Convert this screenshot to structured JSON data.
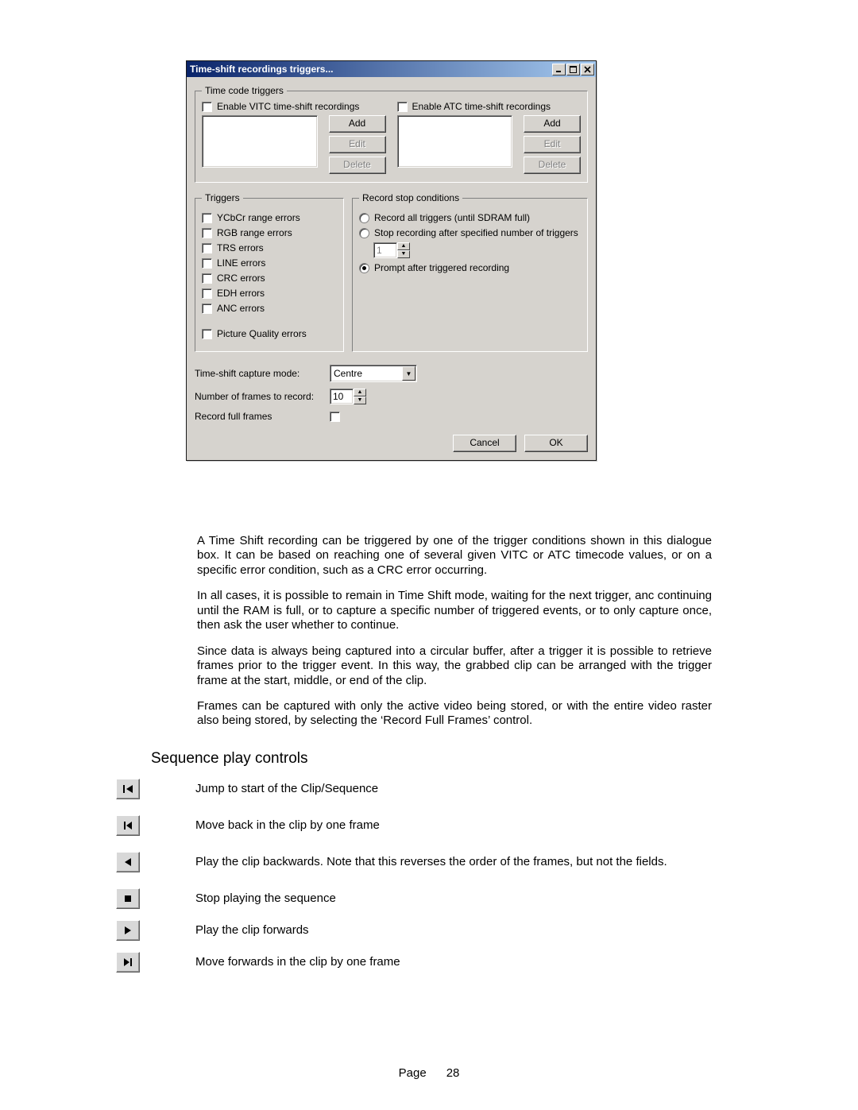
{
  "dialog": {
    "title": "Time-shift recordings triggers...",
    "timecode_triggers": {
      "legend": "Time code triggers",
      "vitc_label": "Enable VITC time-shift recordings",
      "atc_label": "Enable ATC time-shift recordings",
      "add_label": "Add",
      "edit_label": "Edit",
      "delete_label": "Delete"
    },
    "triggers": {
      "legend": "Triggers",
      "items": [
        "YCbCr range errors",
        "RGB range errors",
        "TRS  errors",
        "LINE  errors",
        "CRC  errors",
        "EDH  errors",
        "ANC  errors",
        "Picture Quality errors"
      ]
    },
    "stop": {
      "legend": "Record stop conditions",
      "opt_all": "Record all triggers (until SDRAM full)",
      "opt_num": "Stop recording after specified number of triggers",
      "num_value": "1",
      "opt_prompt": "Prompt after triggered recording",
      "selected": "prompt"
    },
    "capture_mode": {
      "label": "Time-shift capture mode:",
      "value": "Centre"
    },
    "frames": {
      "label": "Number of frames to record:",
      "value": "10"
    },
    "full_frames_label": "Record full frames",
    "cancel": "Cancel",
    "ok": "OK"
  },
  "paragraphs": [
    "A Time Shift recording can be triggered by one of the trigger conditions shown in this dialogue box.  It can be based on reaching one of several given VITC or ATC timecode values, or on a specific error condition, such as a CRC error occurring.",
    "In all cases, it is possible to remain in Time Shift mode, waiting for the next trigger, anc continuing until the RAM is full, or to capture a specific number of triggered events, or to only capture once, then ask the user whether to continue.",
    "Since data is always being captured into a circular buffer, after a trigger it is possible to retrieve frames prior to the trigger event.  In this way, the grabbed clip can be arranged with the trigger frame at the start, middle, or end of the clip.",
    "Frames can be captured with only the active video being stored, or with the entire video raster also being stored, by selecting the ‘Record Full Frames’ control."
  ],
  "section_heading": "Sequence play controls",
  "controls": [
    {
      "icon": "skip-start",
      "desc": "Jump to start of the Clip/Sequence"
    },
    {
      "icon": "step-back",
      "desc": "Move back in the clip by one frame"
    },
    {
      "icon": "play-back",
      "desc": "Play the clip backwards. Note that this reverses the order of the frames, but not the fields."
    },
    {
      "icon": "stop",
      "desc": "Stop playing the sequence"
    },
    {
      "icon": "play-fwd",
      "desc": "Play the clip forwards",
      "no_icon_gap": true
    },
    {
      "icon": "step-fwd",
      "desc": "Move forwards in the clip by one frame"
    }
  ],
  "page_label": "Page",
  "page_number": "28"
}
